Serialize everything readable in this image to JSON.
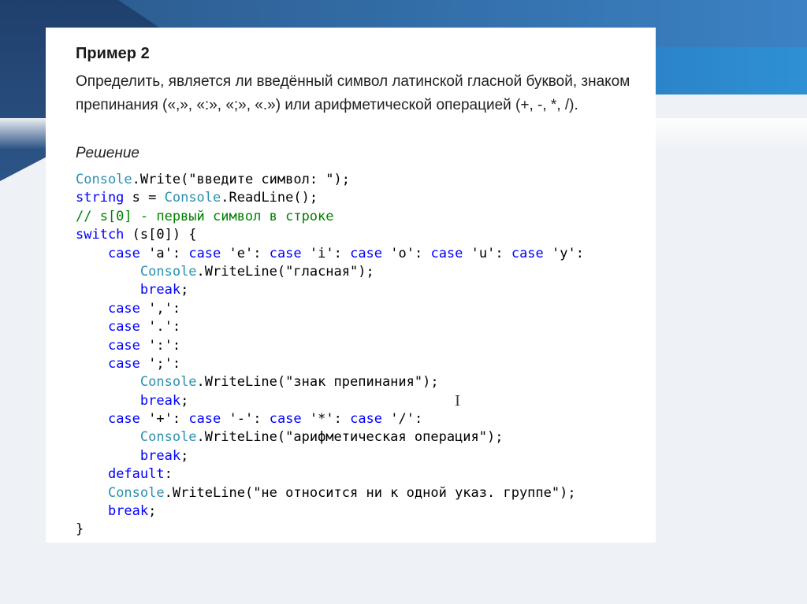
{
  "slide": {
    "example_title": "Пример 2",
    "task_text": "Определить, является ли введённый символ латинской гласной буквой, знаком препинания («,», «:», «;», «.») или арифметической операцией (+, -, *, /).",
    "solution_heading": "Решение",
    "code_lines": [
      [
        {
          "t": "Console",
          "c": "cls"
        },
        {
          "t": ".Write(\"введите символ: \");",
          "c": ""
        }
      ],
      [
        {
          "t": "string",
          "c": "kw"
        },
        {
          "t": " s = ",
          "c": ""
        },
        {
          "t": "Console",
          "c": "cls"
        },
        {
          "t": ".ReadLine();",
          "c": ""
        }
      ],
      [
        {
          "t": "// s[0] - первый символ в строке",
          "c": "cm"
        }
      ],
      [
        {
          "t": "switch",
          "c": "kw"
        },
        {
          "t": " (s[0]) {",
          "c": ""
        }
      ],
      [
        {
          "t": "    ",
          "c": ""
        },
        {
          "t": "case",
          "c": "kw"
        },
        {
          "t": " 'a': ",
          "c": ""
        },
        {
          "t": "case",
          "c": "kw"
        },
        {
          "t": " 'e': ",
          "c": ""
        },
        {
          "t": "case",
          "c": "kw"
        },
        {
          "t": " 'i': ",
          "c": ""
        },
        {
          "t": "case",
          "c": "kw"
        },
        {
          "t": " 'o': ",
          "c": ""
        },
        {
          "t": "case",
          "c": "kw"
        },
        {
          "t": " 'u': ",
          "c": ""
        },
        {
          "t": "case",
          "c": "kw"
        },
        {
          "t": " 'y':",
          "c": ""
        }
      ],
      [
        {
          "t": "        ",
          "c": ""
        },
        {
          "t": "Console",
          "c": "cls"
        },
        {
          "t": ".WriteLine(\"гласная\");",
          "c": ""
        }
      ],
      [
        {
          "t": "        ",
          "c": ""
        },
        {
          "t": "break",
          "c": "kw"
        },
        {
          "t": ";",
          "c": ""
        }
      ],
      [
        {
          "t": "    ",
          "c": ""
        },
        {
          "t": "case",
          "c": "kw"
        },
        {
          "t": " ',':",
          "c": ""
        }
      ],
      [
        {
          "t": "    ",
          "c": ""
        },
        {
          "t": "case",
          "c": "kw"
        },
        {
          "t": " '.':",
          "c": ""
        }
      ],
      [
        {
          "t": "    ",
          "c": ""
        },
        {
          "t": "case",
          "c": "kw"
        },
        {
          "t": " ':':",
          "c": ""
        }
      ],
      [
        {
          "t": "    ",
          "c": ""
        },
        {
          "t": "case",
          "c": "kw"
        },
        {
          "t": " ';':",
          "c": ""
        }
      ],
      [
        {
          "t": "        ",
          "c": ""
        },
        {
          "t": "Console",
          "c": "cls"
        },
        {
          "t": ".WriteLine(\"знак препинания\");",
          "c": ""
        }
      ],
      [
        {
          "t": "        ",
          "c": ""
        },
        {
          "t": "break",
          "c": "kw"
        },
        {
          "t": ";",
          "c": ""
        }
      ],
      [
        {
          "t": "    ",
          "c": ""
        },
        {
          "t": "case",
          "c": "kw"
        },
        {
          "t": " '+': ",
          "c": ""
        },
        {
          "t": "case",
          "c": "kw"
        },
        {
          "t": " '-': ",
          "c": ""
        },
        {
          "t": "case",
          "c": "kw"
        },
        {
          "t": " '*': ",
          "c": ""
        },
        {
          "t": "case",
          "c": "kw"
        },
        {
          "t": " '/':",
          "c": ""
        }
      ],
      [
        {
          "t": "        ",
          "c": ""
        },
        {
          "t": "Console",
          "c": "cls"
        },
        {
          "t": ".WriteLine(\"арифметическая операция\");",
          "c": ""
        }
      ],
      [
        {
          "t": "        ",
          "c": ""
        },
        {
          "t": "break",
          "c": "kw"
        },
        {
          "t": ";",
          "c": ""
        }
      ],
      [
        {
          "t": "    ",
          "c": ""
        },
        {
          "t": "default",
          "c": "kw"
        },
        {
          "t": ":",
          "c": ""
        }
      ],
      [
        {
          "t": "    ",
          "c": ""
        },
        {
          "t": "Console",
          "c": "cls"
        },
        {
          "t": ".WriteLine(\"не относится ни к одной указ. группе\");",
          "c": ""
        }
      ],
      [
        {
          "t": "    ",
          "c": ""
        },
        {
          "t": "break",
          "c": "kw"
        },
        {
          "t": ";",
          "c": ""
        }
      ],
      [
        {
          "t": "}",
          "c": ""
        }
      ]
    ],
    "cursor_glyph": "I"
  },
  "colors": {
    "keyword": "#0000ff",
    "class_name": "#2b91af",
    "comment": "#008000",
    "text": "#000000",
    "header_dark": "#1f3f6c",
    "header_blue": "#3b82c4"
  }
}
